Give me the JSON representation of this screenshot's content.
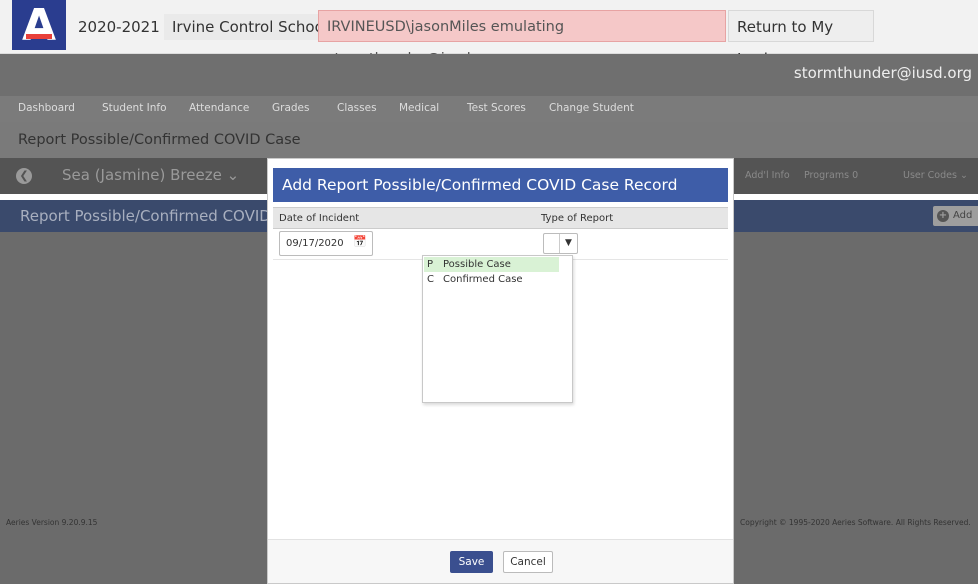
{
  "topbar": {
    "school_year": "2020-2021",
    "school_name": "Irvine Control School",
    "emulating_text": "IRVINEUSD\\jasonMiles emulating stormthunder@iusd.org",
    "return_login_label": "Return to My Login",
    "user_email": "stormthunder@iusd.org"
  },
  "nav": {
    "items": [
      "Dashboard",
      "Student Info",
      "Attendance",
      "Grades",
      "Classes",
      "Medical",
      "Test Scores",
      "Change Student"
    ]
  },
  "page": {
    "title": "Report Possible/Confirmed COVID Case"
  },
  "student": {
    "name": "Sea (Jasmine) Breeze",
    "nav_items": [
      "Add'l Info",
      "Programs",
      "User Codes"
    ],
    "programs_count": "0"
  },
  "section": {
    "title": "Report Possible/Confirmed COVID Case",
    "add_label": "Add"
  },
  "footer": {
    "version": "Aeries Version 9.20.9.15",
    "copyright": "Copyright © 1995-2020 Aeries Software. All Rights Reserved."
  },
  "modal": {
    "title": "Add Report Possible/Confirmed COVID Case Record",
    "columns": [
      "Date of Incident",
      "Type of Report"
    ],
    "date_value": "09/17/2020",
    "type_options": [
      {
        "code": "P",
        "label": "Possible Case"
      },
      {
        "code": "C",
        "label": "Confirmed Case"
      }
    ],
    "save_label": "Save",
    "cancel_label": "Cancel"
  },
  "icons": {
    "back": "arrow-left-circle-icon",
    "calendar": "calendar-icon",
    "dropdown": "caret-down-icon",
    "add": "plus-circle-icon"
  },
  "colors": {
    "modal_header": "#3e5da8",
    "save_button": "#3a4f8f",
    "selected_option": "#d9f2d5",
    "emulating_banner": "#f5c8c8"
  }
}
